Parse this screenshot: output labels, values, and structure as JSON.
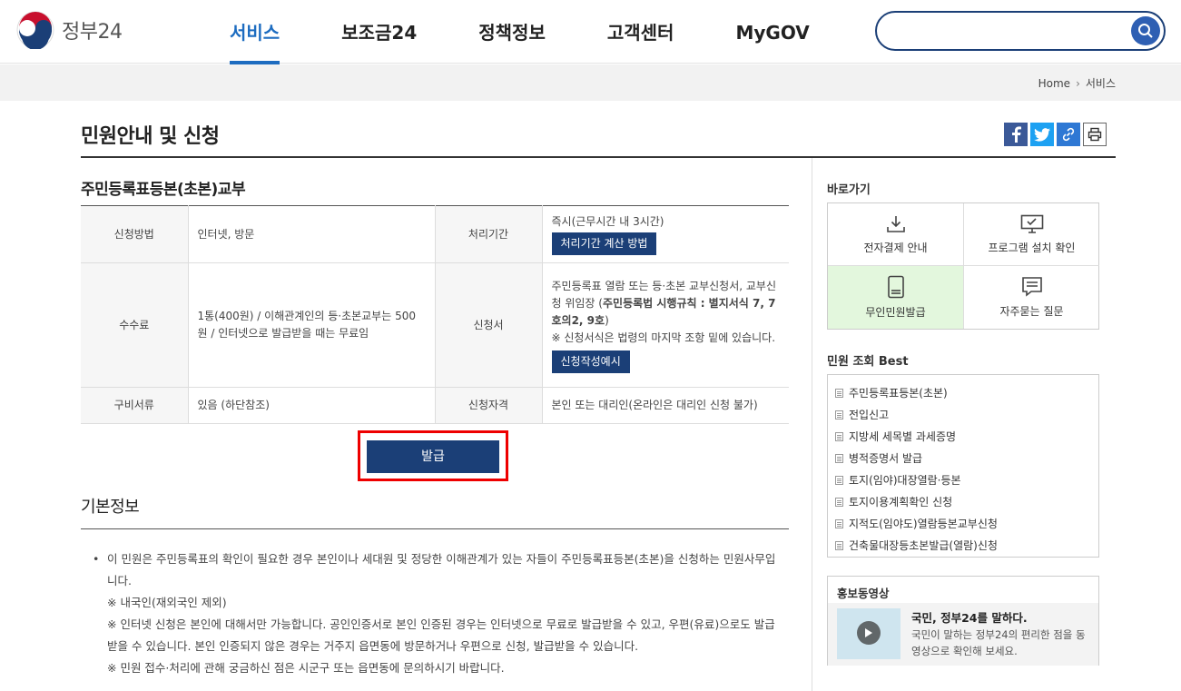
{
  "header": {
    "logo_text": "정부24",
    "nav": [
      "서비스",
      "보조금24",
      "정책정보",
      "고객센터",
      "MyGOV"
    ],
    "search_placeholder": ""
  },
  "breadcrumb": {
    "home": "Home",
    "current": "서비스"
  },
  "page_title": "민원안내 및 신청",
  "service_title": "주민등록표등본(초본)교부",
  "info": {
    "method_label": "신청방법",
    "method_value": "인터넷, 방문",
    "period_label": "처리기간",
    "period_value": "즉시(근무시간 내 3시간)",
    "period_button": "처리기간 계산 방법",
    "fee_label": "수수료",
    "fee_value": "1통(400원) / 이해관계인의 등·초본교부는 500원 / 인터넷으로 발급받을 때는 무료임",
    "form_label": "신청서",
    "form_value_1": "주민등록표 열람 또는 등·초본 교부신청서, 교부신청 위임장 (",
    "form_value_bold": "주민등록법 시행규칙 : 별지서식 7, 7호의2, 9호",
    "form_value_2": ")",
    "form_note": "※ 신청서식은 법령의 마지막 조항 밑에 있습니다.",
    "form_button": "신청작성예시",
    "docs_label": "구비서류",
    "docs_value": "있음 (하단참조)",
    "qual_label": "신청자격",
    "qual_value": "본인 또는 대리인(온라인은 대리인 신청 불가)"
  },
  "issue_button": "발급",
  "basic_title": "기본정보",
  "basic_lines": [
    "이 민원은 주민등록표의 확인이 필요한 경우 본인이나 세대원 및 정당한 이해관계가 있는 자들이 주민등록표등본(초본)을 신청하는 민원사무입니다.",
    "※ 내국인(재외국인 제외)",
    "※ 인터넷 신청은 본인에 대해서만 가능합니다. 공인인증서로 본인 인증된 경우는 인터넷으로 무료로 발급받을 수 있고, 우편(유료)으로도 발급받을 수 있습니다. 본인 인증되지 않은 경우는 거주지 읍면동에 방문하거나 우편으로 신청, 발급받을 수 있습니다.",
    "※ 민원 접수·처리에 관해 궁금하신 점은 시군구 또는 읍면동에 문의하시기 바랍니다."
  ],
  "sidebar": {
    "quick_title": "바로가기",
    "quick": [
      "전자결제 안내",
      "프로그램 설치 확인",
      "무인민원발급",
      "자주묻는 질문"
    ],
    "best_title": "민원 조회 Best",
    "best": [
      "주민등록표등본(초본)",
      "전입신고",
      "지방세 세목별 과세증명",
      "병적증명서 발급",
      "토지(임야)대장열람·등본",
      "토지이용계획확인 신청",
      "지적도(임야도)열람등본교부신청",
      "건축물대장등초본발급(열람)신청"
    ],
    "promo_title": "홍보동영상",
    "promo_head": "국민, 정부24를 말하다.",
    "promo_desc": "국민이 말하는 정부24의 편리한 점을 동영상으로 확인해 보세요."
  },
  "colors": {
    "accent": "#1d6cc0",
    "navy": "#1b3f77",
    "highlight": "#e00000"
  }
}
